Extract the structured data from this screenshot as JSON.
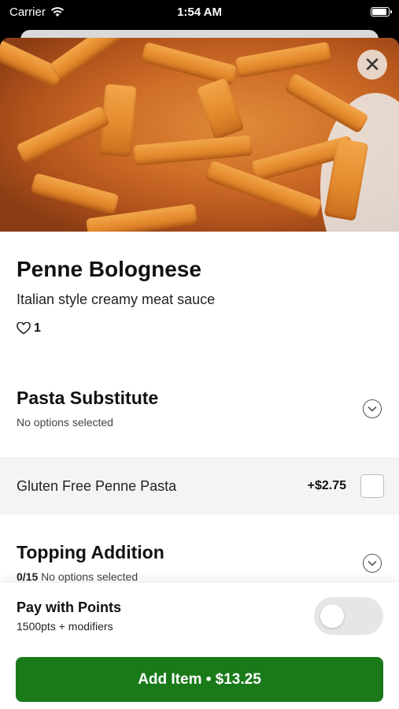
{
  "status_bar": {
    "carrier": "Carrier",
    "time": "1:54 AM"
  },
  "item": {
    "name": "Penne Bolognese",
    "description": "Italian style creamy meat sauce",
    "likes": "1"
  },
  "sections": [
    {
      "title": "Pasta Substitute",
      "status": "No options selected",
      "count": ""
    },
    {
      "title": "Topping Addition",
      "status": "No options selected",
      "count": "0/15"
    }
  ],
  "options": [
    {
      "label": "Gluten Free Penne Pasta",
      "price": "+$2.75",
      "checked": false
    }
  ],
  "footer": {
    "points_title": "Pay with Points",
    "points_subtitle": "1500pts + modifiers",
    "points_enabled": false,
    "add_button": "Add Item • $13.25"
  },
  "colors": {
    "primary_button": "#1a7a1a",
    "option_row_bg": "#f4f4f4"
  },
  "icons": [
    "wifi-icon",
    "battery-icon",
    "close-icon",
    "heart-icon",
    "chevron-down-icon",
    "checkbox-icon",
    "toggle-switch"
  ]
}
